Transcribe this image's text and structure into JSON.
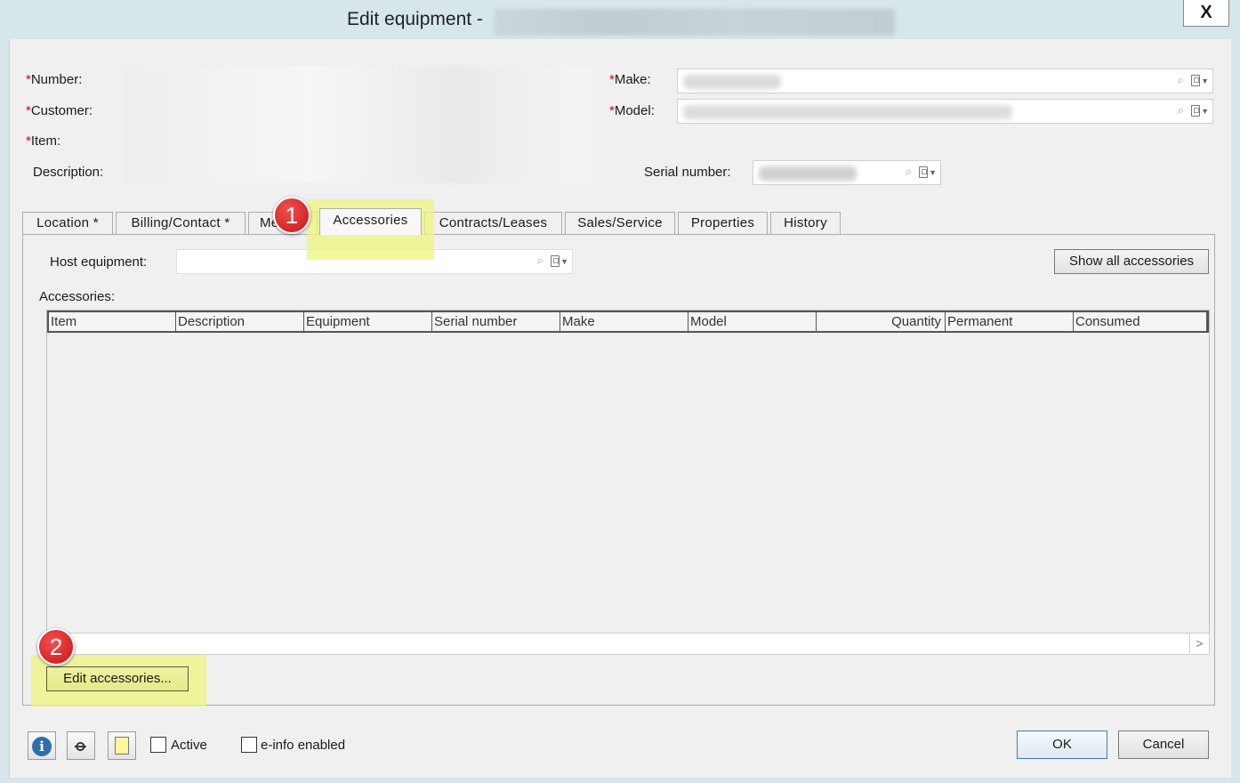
{
  "window": {
    "title": "Edit equipment -",
    "close_label": "X"
  },
  "header": {
    "number_label": "Number:",
    "customer_label": "Customer:",
    "item_label": "Item:",
    "description_label": "Description:",
    "make_label": "Make:",
    "model_label": "Model:",
    "serial_number_label": "Serial number:",
    "required_marker": "*"
  },
  "tabs": [
    {
      "label": "Location *"
    },
    {
      "label": "Billing/Contact *"
    },
    {
      "label": "Me"
    },
    {
      "label": "Accessories"
    },
    {
      "label": "Contracts/Leases"
    },
    {
      "label": "Sales/Service"
    },
    {
      "label": "Properties"
    },
    {
      "label": "History"
    }
  ],
  "accessories_tab": {
    "host_equipment_label": "Host equipment:",
    "show_all_button": "Show all accessories",
    "accessories_label": "Accessories:",
    "columns": [
      "Item",
      "Description",
      "Equipment",
      "Serial number",
      "Make",
      "Model",
      "Quantity",
      "Permanent",
      "Consumed"
    ],
    "edit_button": "Edit accessories..."
  },
  "annotations": {
    "badge1": "1",
    "badge2": "2",
    "highlight_color": "#eef67e",
    "badge_color": "#d91c1c"
  },
  "footer": {
    "active_label": "Active",
    "einfo_label": "e-info enabled",
    "ok_button": "OK",
    "cancel_button": "Cancel"
  },
  "icons": {
    "info": "info-icon",
    "attach": "paperclip-icon",
    "document": "document-icon",
    "search": "magnifier-icon",
    "lookup": "flag-dropdown-icon"
  }
}
